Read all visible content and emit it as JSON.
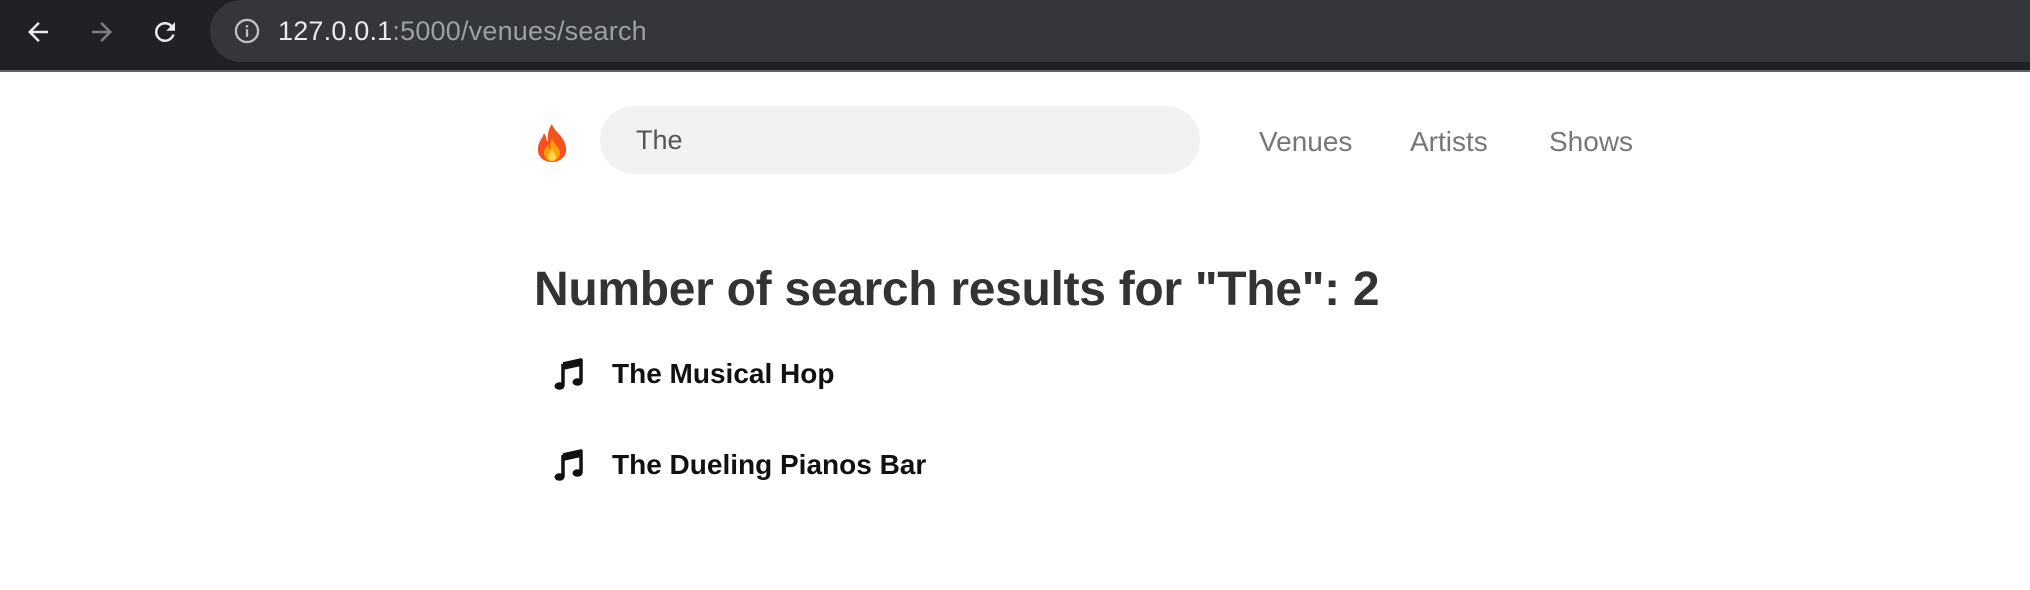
{
  "browser": {
    "url_host": "127.0.0.1",
    "url_rest": ":5000/venues/search",
    "icons": {
      "back": "arrow-left-icon",
      "forward": "arrow-right-icon",
      "reload": "reload-icon",
      "site_info": "info-icon"
    }
  },
  "navbar": {
    "logo_icon": "fire-icon",
    "search": {
      "value": "The"
    },
    "links": {
      "venues": "Venues",
      "artists": "Artists",
      "shows": "Shows"
    }
  },
  "results": {
    "title": "Number of search results for \"The\": 2",
    "items": [
      {
        "name": "The Musical Hop",
        "icon": "music-note-icon"
      },
      {
        "name": "The Dueling Pianos Bar",
        "icon": "music-note-icon"
      }
    ]
  },
  "colors": {
    "chrome_bg": "#202124",
    "omnibox_bg": "#35363a",
    "search_bg": "#f2f2f2",
    "nav_link": "#777777",
    "title": "#333333"
  }
}
